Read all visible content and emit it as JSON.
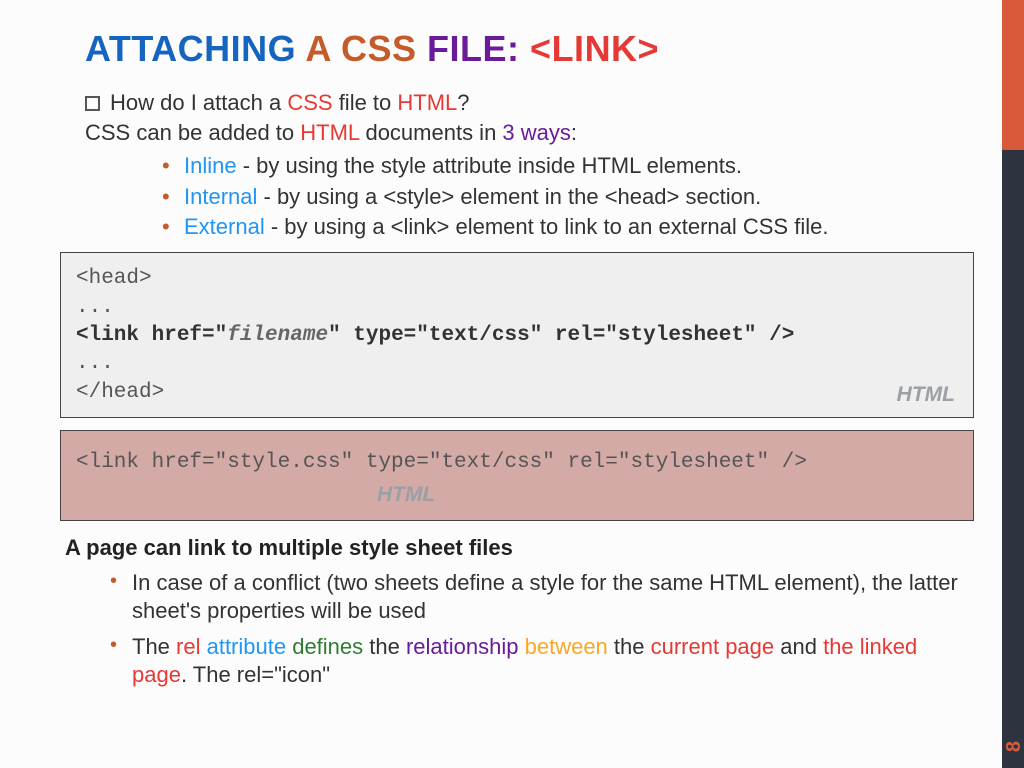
{
  "page_number": "8",
  "title": {
    "w1": "ATTACHING",
    "w2": "A",
    "w3": "CSS",
    "w4": "FILE:",
    "w5": "<LINK>"
  },
  "intro": {
    "q_pre": "How do I attach a ",
    "q_css": "CSS",
    "q_mid": " file to ",
    "q_html": "HTML",
    "q_end": "?",
    "line2_a": "CSS can be added to ",
    "line2_html": "HTML",
    "line2_b": " documents in ",
    "line2_ways": "3 ways",
    "line2_c": ":"
  },
  "methods": [
    {
      "name": "Inline",
      "desc": " - by using the style attribute inside HTML elements."
    },
    {
      "name": "Internal",
      "desc": " - by using a <style> element in the <head> section."
    },
    {
      "name": "External",
      "desc": " - by using a <link> element to link to an external CSS file."
    }
  ],
  "code1": {
    "l1": "<head>",
    "l2": "...",
    "l3a": "<link href=\"",
    "l3b": "filename",
    "l3c": "\" type=\"text/css\" rel=\"stylesheet\" />",
    "l4": "...",
    "l5": "</head>",
    "label": "HTML"
  },
  "code2": {
    "line": "<link href=\"style.css\" type=\"text/css\" rel=\"stylesheet\" />",
    "label": "HTML"
  },
  "subhead": "A page can link to multiple style sheet files",
  "sub_items": {
    "i1": "In case of a conflict (two sheets define a style for the same HTML element), the latter sheet's properties will be used",
    "i2": {
      "w1": "The ",
      "w2": "rel ",
      "w3": "attribute ",
      "w4": "defines ",
      "w5": "the ",
      "w6": "relationship ",
      "w7": "between ",
      "w8": "the ",
      "w9": "current page ",
      "w10": "and ",
      "w11": "the linked page",
      "w12": ". The rel=\"icon\""
    }
  }
}
